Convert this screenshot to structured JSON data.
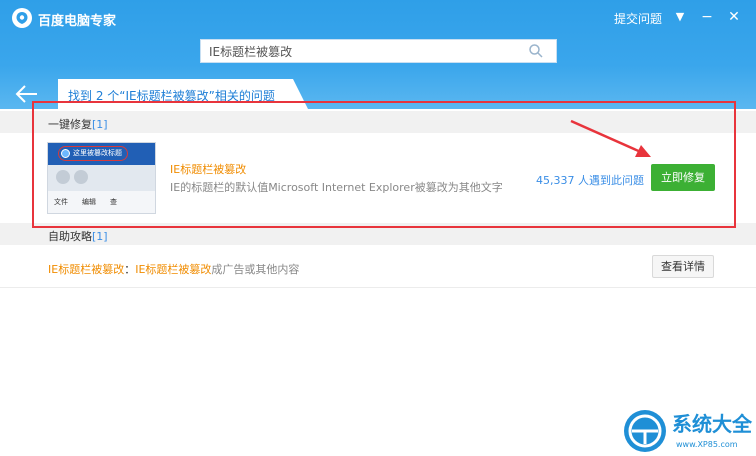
{
  "app": {
    "title": "百度电脑专家",
    "topbar_link": "提交问题",
    "controls": {
      "menu": "▼",
      "minimize": "−",
      "close": "✕"
    }
  },
  "search": {
    "value": "IE标题栏被篡改",
    "placeholder": ""
  },
  "result_tab": {
    "label": "找到 2 个“IE标题栏被篡改”相关的问题"
  },
  "one_click_fix": {
    "heading": "一键修复",
    "count": "[1]",
    "item": {
      "thumbnail": {
        "title": "这里被篡改标题",
        "menu": [
          "文件",
          "编辑",
          "查"
        ]
      },
      "title": "IE标题栏被篡改",
      "description": "IE的标题栏的默认值Microsoft Internet Explorer被篡改为其他文字",
      "count": "45,337 人遇到此问题",
      "button": "立即修复"
    }
  },
  "guide": {
    "heading": "自助攻略",
    "count": "[1]",
    "item": {
      "key": "IE标题栏被篡改",
      "sep": "：",
      "link": "IE标题栏被篡改",
      "rest": "成广告或其他内容",
      "button": "查看详情"
    }
  },
  "watermark": {
    "text": "系统大全",
    "url": "www.XP85.com"
  },
  "colors": {
    "header_blue": "#2f9fe8",
    "accent_orange": "#f08c00",
    "link_blue": "#3a8ee6",
    "fix_green": "#3cb034",
    "annotation_red": "#e8343c"
  }
}
